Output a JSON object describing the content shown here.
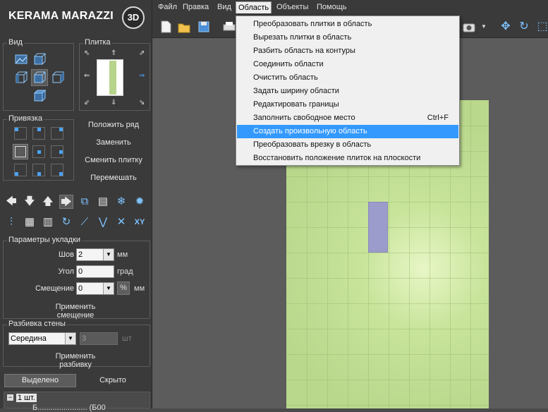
{
  "logo": {
    "text": "KERAMA MARAZZI",
    "badge": "3D"
  },
  "menubar": {
    "items": [
      "Файл",
      "Правка",
      "Вид",
      "Область",
      "Объекты",
      "Помощь"
    ]
  },
  "dropdown": {
    "items": [
      {
        "label": "Преобразовать плитки в область",
        "shortcut": ""
      },
      {
        "label": "Вырезать плитки в область",
        "shortcut": ""
      },
      {
        "label": "Разбить область на контуры",
        "shortcut": ""
      },
      {
        "label": "Соединить области",
        "shortcut": ""
      },
      {
        "label": "Очистить область",
        "shortcut": ""
      },
      {
        "label": "Задать ширину области",
        "shortcut": ""
      },
      {
        "label": "Редактировать границы",
        "shortcut": ""
      },
      {
        "label": "Заполнить свободное место",
        "shortcut": "Ctrl+F"
      },
      {
        "label": "Создать произвольную область",
        "shortcut": "",
        "highlighted": true
      },
      {
        "label": "Преобразовать врезку в область",
        "shortcut": ""
      },
      {
        "label": "Восстановить положение плиток на плоскости",
        "shortcut": ""
      }
    ]
  },
  "panel": {
    "view_title": "Вид",
    "tile_title": "Плитка",
    "snap_title": "Привязка",
    "actions": {
      "lay_row": "Положить ряд",
      "replace": "Заменить",
      "change_tile": "Сменить плитку",
      "shuffle": "Перемешать"
    },
    "layout_params": {
      "title": "Параметры укладки",
      "seam_label": "Шов",
      "seam_value": "2",
      "seam_unit": "мм",
      "angle_label": "Угол",
      "angle_value": "0",
      "angle_unit": "град",
      "offset_label": "Смещение",
      "offset_value": "0",
      "offset_pct": "%",
      "offset_unit": "мм",
      "apply_offset": "Применить смещение"
    },
    "wall_split": {
      "title": "Разбивка стены",
      "mode_value": "Середина",
      "count_value": "3",
      "count_unit": "шт",
      "apply_split": "Применить разбивку"
    },
    "tabs": {
      "selected": "Выделено",
      "hidden": "Скрыто"
    },
    "tree": {
      "node": "1 шт.",
      "child_partial": "Б....................... (Б00"
    }
  },
  "colors": {
    "accent": "#3399ff",
    "wall": "#c7e49a",
    "selected_tile": "#9b9ccb"
  },
  "icons": {
    "toolbar": [
      "new-file-icon",
      "open-folder-icon",
      "save-icon",
      "print-icon",
      "camera-icon",
      "move-icon",
      "rotate-icon",
      "crop-icon"
    ]
  }
}
